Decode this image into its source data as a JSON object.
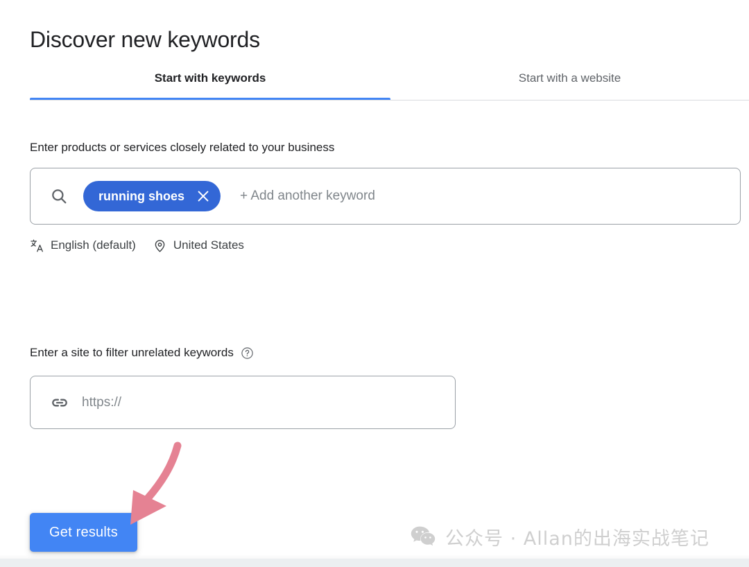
{
  "page": {
    "title": "Discover new keywords"
  },
  "tabs": [
    {
      "label": "Start with keywords",
      "active": true
    },
    {
      "label": "Start with a website",
      "active": false
    }
  ],
  "keywords_section": {
    "label": "Enter products or services closely related to your business",
    "search_icon": "search-icon",
    "chips": [
      {
        "text": "running shoes",
        "remove_icon": "close-icon"
      }
    ],
    "placeholder": "+ Add another keyword",
    "meta": [
      {
        "icon": "translate-icon",
        "label": "English (default)"
      },
      {
        "icon": "location-pin-icon",
        "label": "United States"
      }
    ]
  },
  "site_filter_section": {
    "label": "Enter a site to filter unrelated keywords",
    "help_icon": "help-circle-icon",
    "link_icon": "link-icon",
    "value": "",
    "placeholder": "https://"
  },
  "actions": {
    "get_results_label": "Get results"
  },
  "annotation": {
    "arrow": "arrow-pointing-to-get-results",
    "arrow_color": "#e58293"
  },
  "watermark": {
    "icon": "wechat-icon",
    "text": "公众号 · Allan的出海实战笔记",
    "color": "#cfcfcf"
  },
  "colors": {
    "accent_blue": "#4285f4",
    "chip_blue": "#3367d6",
    "border_gray": "#9aa0a6",
    "divider_gray": "#dadce0",
    "text_primary": "#202124",
    "text_secondary": "#5f6368",
    "placeholder_gray": "#80868b"
  }
}
